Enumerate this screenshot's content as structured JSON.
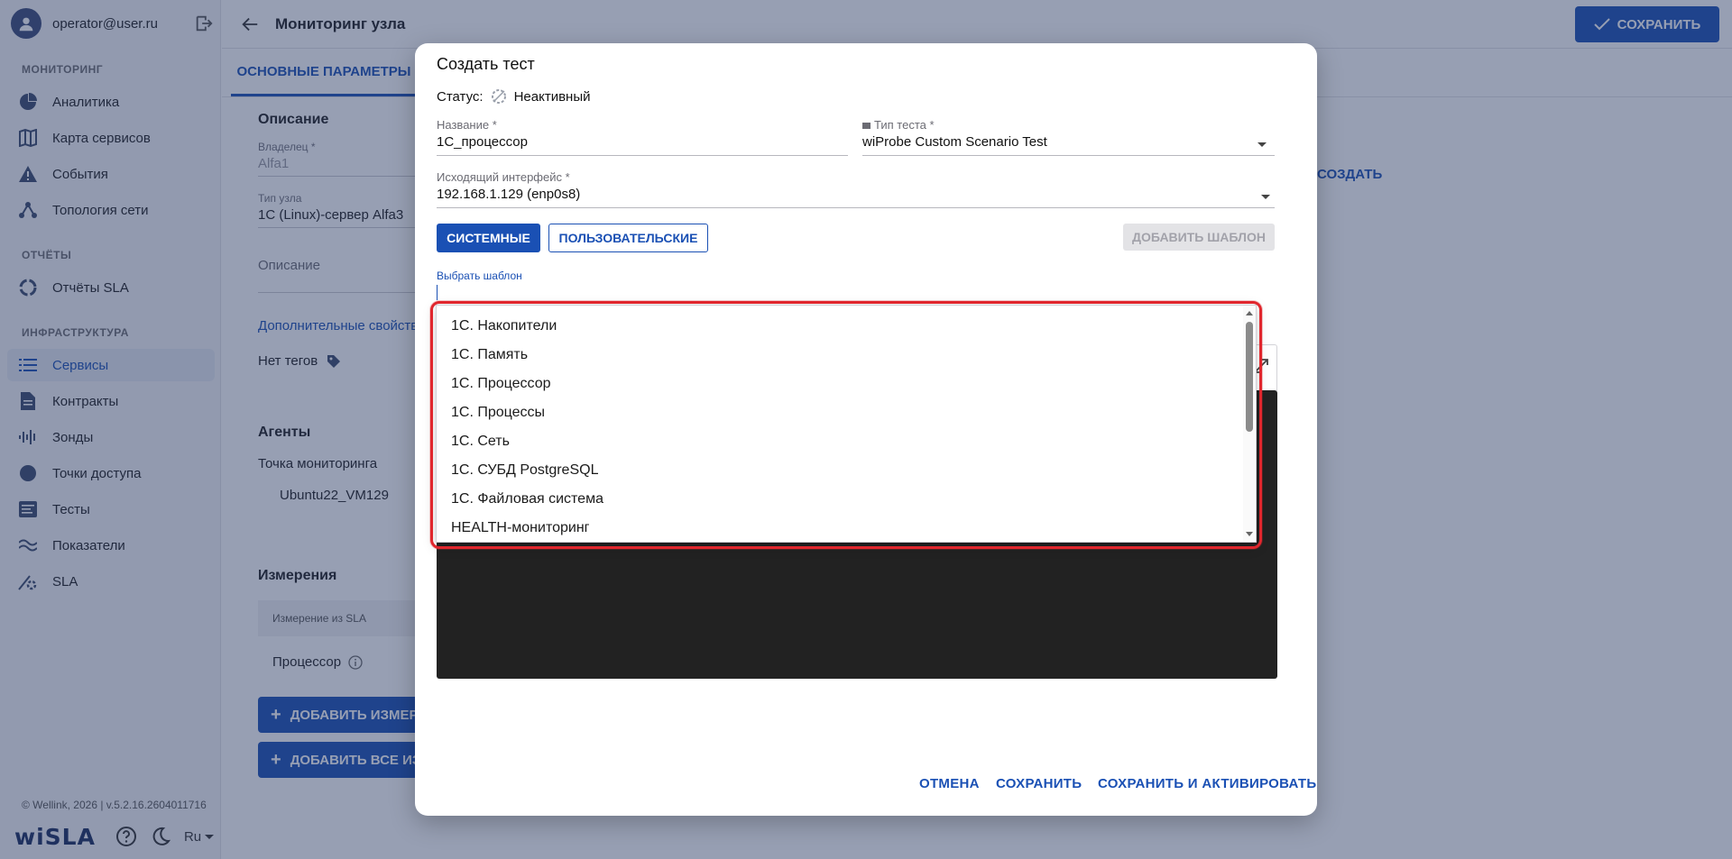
{
  "sidebar": {
    "user_email": "operator@user.ru",
    "sections": {
      "monitoring": "МОНИТОРИНГ",
      "reports": "ОТЧЁТЫ",
      "infra": "ИНФРАСТРУКТУРА"
    },
    "items": [
      {
        "label": "Аналитика",
        "icon": "pie-chart-icon"
      },
      {
        "label": "Карта сервисов",
        "icon": "map-icon"
      },
      {
        "label": "События",
        "icon": "warning-icon"
      },
      {
        "label": "Топология сети",
        "icon": "topology-icon"
      },
      {
        "label": "Отчёты SLA",
        "icon": "report-circle-icon"
      },
      {
        "label": "Сервисы",
        "icon": "list-icon",
        "active": true
      },
      {
        "label": "Контракты",
        "icon": "document-icon"
      },
      {
        "label": "Зонды",
        "icon": "probe-icon"
      },
      {
        "label": "Точки доступа",
        "icon": "access-point-icon"
      },
      {
        "label": "Тесты",
        "icon": "tests-icon"
      },
      {
        "label": "Показатели",
        "icon": "metrics-icon"
      },
      {
        "label": "SLA",
        "icon": "sla-gear-icon"
      }
    ],
    "copyright": "© Wellink, 2026 | v.5.2.16.2604011716",
    "brand": "wiSLA",
    "language": "Ru"
  },
  "header": {
    "title": "Мониторинг узла",
    "save_label": "СОХРАНИТЬ"
  },
  "page": {
    "tab_main": "ОСНОВНЫЕ ПАРАМЕТРЫ",
    "description_heading": "Описание",
    "owner_label": "Владелец *",
    "owner_value": "Alfa1",
    "node_type_label": "Тип узла",
    "node_type_value": "1С (Linux)-сервер Alfa3",
    "description_placeholder": "Описание",
    "extra_props_link": "Дополнительные свойства",
    "no_tags": "Нет тегов",
    "agents_heading": "Агенты",
    "monitoring_point": "Точка мониторинга",
    "agent_name": "Ubuntu22_VM129",
    "measurements_heading": "Измерения",
    "measure_col": "Измерение из SLA",
    "measure_row": "Процессор",
    "add_measure_btn": "ДОБАВИТЬ ИЗМЕРЕНИЕ",
    "add_all_btn": "ДОБАВИТЬ ВСЕ ИЗМЕРЕНИЯ",
    "create_link": "СОЗДАТЬ"
  },
  "modal": {
    "title": "Создать тест",
    "status_label": "Статус:",
    "status_value": "Неактивный",
    "name_label": "Название *",
    "name_value": "1С_процессор",
    "test_type_label": "Тип теста *",
    "test_type_value": "wiProbe Custom Scenario Test",
    "iface_label": "Исходящий интерфейс *",
    "iface_value": "192.168.1.129 (enp0s8)",
    "btn_system": "СИСТЕМНЫЕ",
    "btn_user": "ПОЛЬЗОВАТЕЛЬСКИЕ",
    "btn_add_template": "ДОБАВИТЬ ШАБЛОН",
    "pick_template_label": "Выбрать шаблон",
    "footer_cancel": "ОТМЕНА",
    "footer_save": "СОХРАНИТЬ",
    "footer_save_activate": "СОХРАНИТЬ И АКТИВИРОВАТЬ"
  },
  "dropdown": {
    "options": [
      "1С. Накопители",
      "1С. Память",
      "1С. Процессор",
      "1С. Процессы",
      "1С. Сеть",
      "1С. СУБД PostgreSQL",
      "1С. Файловая система",
      "HEALTH-мониторинг"
    ]
  },
  "colors": {
    "accent": "#1a50b4",
    "overlay": "#263660",
    "highlight": "#e0262d",
    "editor_bg": "#222222"
  }
}
